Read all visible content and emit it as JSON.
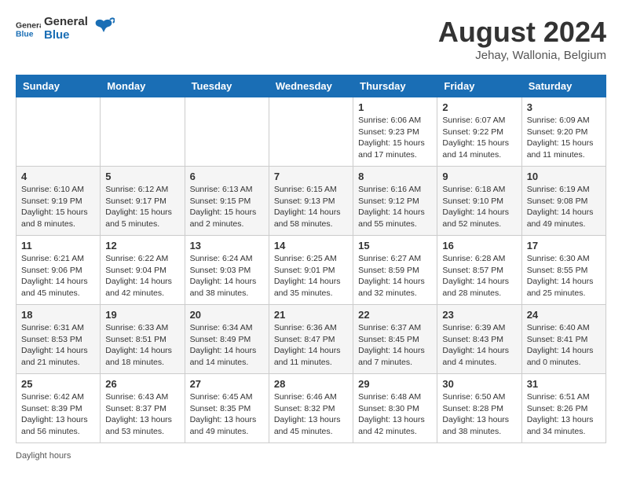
{
  "header": {
    "logo_general": "General",
    "logo_blue": "Blue",
    "month_title": "August 2024",
    "location": "Jehay, Wallonia, Belgium"
  },
  "weekdays": [
    "Sunday",
    "Monday",
    "Tuesday",
    "Wednesday",
    "Thursday",
    "Friday",
    "Saturday"
  ],
  "weeks": [
    [
      {
        "day": "",
        "info": ""
      },
      {
        "day": "",
        "info": ""
      },
      {
        "day": "",
        "info": ""
      },
      {
        "day": "",
        "info": ""
      },
      {
        "day": "1",
        "info": "Sunrise: 6:06 AM\nSunset: 9:23 PM\nDaylight: 15 hours and 17 minutes."
      },
      {
        "day": "2",
        "info": "Sunrise: 6:07 AM\nSunset: 9:22 PM\nDaylight: 15 hours and 14 minutes."
      },
      {
        "day": "3",
        "info": "Sunrise: 6:09 AM\nSunset: 9:20 PM\nDaylight: 15 hours and 11 minutes."
      }
    ],
    [
      {
        "day": "4",
        "info": "Sunrise: 6:10 AM\nSunset: 9:19 PM\nDaylight: 15 hours and 8 minutes."
      },
      {
        "day": "5",
        "info": "Sunrise: 6:12 AM\nSunset: 9:17 PM\nDaylight: 15 hours and 5 minutes."
      },
      {
        "day": "6",
        "info": "Sunrise: 6:13 AM\nSunset: 9:15 PM\nDaylight: 15 hours and 2 minutes."
      },
      {
        "day": "7",
        "info": "Sunrise: 6:15 AM\nSunset: 9:13 PM\nDaylight: 14 hours and 58 minutes."
      },
      {
        "day": "8",
        "info": "Sunrise: 6:16 AM\nSunset: 9:12 PM\nDaylight: 14 hours and 55 minutes."
      },
      {
        "day": "9",
        "info": "Sunrise: 6:18 AM\nSunset: 9:10 PM\nDaylight: 14 hours and 52 minutes."
      },
      {
        "day": "10",
        "info": "Sunrise: 6:19 AM\nSunset: 9:08 PM\nDaylight: 14 hours and 49 minutes."
      }
    ],
    [
      {
        "day": "11",
        "info": "Sunrise: 6:21 AM\nSunset: 9:06 PM\nDaylight: 14 hours and 45 minutes."
      },
      {
        "day": "12",
        "info": "Sunrise: 6:22 AM\nSunset: 9:04 PM\nDaylight: 14 hours and 42 minutes."
      },
      {
        "day": "13",
        "info": "Sunrise: 6:24 AM\nSunset: 9:03 PM\nDaylight: 14 hours and 38 minutes."
      },
      {
        "day": "14",
        "info": "Sunrise: 6:25 AM\nSunset: 9:01 PM\nDaylight: 14 hours and 35 minutes."
      },
      {
        "day": "15",
        "info": "Sunrise: 6:27 AM\nSunset: 8:59 PM\nDaylight: 14 hours and 32 minutes."
      },
      {
        "day": "16",
        "info": "Sunrise: 6:28 AM\nSunset: 8:57 PM\nDaylight: 14 hours and 28 minutes."
      },
      {
        "day": "17",
        "info": "Sunrise: 6:30 AM\nSunset: 8:55 PM\nDaylight: 14 hours and 25 minutes."
      }
    ],
    [
      {
        "day": "18",
        "info": "Sunrise: 6:31 AM\nSunset: 8:53 PM\nDaylight: 14 hours and 21 minutes."
      },
      {
        "day": "19",
        "info": "Sunrise: 6:33 AM\nSunset: 8:51 PM\nDaylight: 14 hours and 18 minutes."
      },
      {
        "day": "20",
        "info": "Sunrise: 6:34 AM\nSunset: 8:49 PM\nDaylight: 14 hours and 14 minutes."
      },
      {
        "day": "21",
        "info": "Sunrise: 6:36 AM\nSunset: 8:47 PM\nDaylight: 14 hours and 11 minutes."
      },
      {
        "day": "22",
        "info": "Sunrise: 6:37 AM\nSunset: 8:45 PM\nDaylight: 14 hours and 7 minutes."
      },
      {
        "day": "23",
        "info": "Sunrise: 6:39 AM\nSunset: 8:43 PM\nDaylight: 14 hours and 4 minutes."
      },
      {
        "day": "24",
        "info": "Sunrise: 6:40 AM\nSunset: 8:41 PM\nDaylight: 14 hours and 0 minutes."
      }
    ],
    [
      {
        "day": "25",
        "info": "Sunrise: 6:42 AM\nSunset: 8:39 PM\nDaylight: 13 hours and 56 minutes."
      },
      {
        "day": "26",
        "info": "Sunrise: 6:43 AM\nSunset: 8:37 PM\nDaylight: 13 hours and 53 minutes."
      },
      {
        "day": "27",
        "info": "Sunrise: 6:45 AM\nSunset: 8:35 PM\nDaylight: 13 hours and 49 minutes."
      },
      {
        "day": "28",
        "info": "Sunrise: 6:46 AM\nSunset: 8:32 PM\nDaylight: 13 hours and 45 minutes."
      },
      {
        "day": "29",
        "info": "Sunrise: 6:48 AM\nSunset: 8:30 PM\nDaylight: 13 hours and 42 minutes."
      },
      {
        "day": "30",
        "info": "Sunrise: 6:50 AM\nSunset: 8:28 PM\nDaylight: 13 hours and 38 minutes."
      },
      {
        "day": "31",
        "info": "Sunrise: 6:51 AM\nSunset: 8:26 PM\nDaylight: 13 hours and 34 minutes."
      }
    ]
  ],
  "footer": {
    "daylight_label": "Daylight hours"
  }
}
